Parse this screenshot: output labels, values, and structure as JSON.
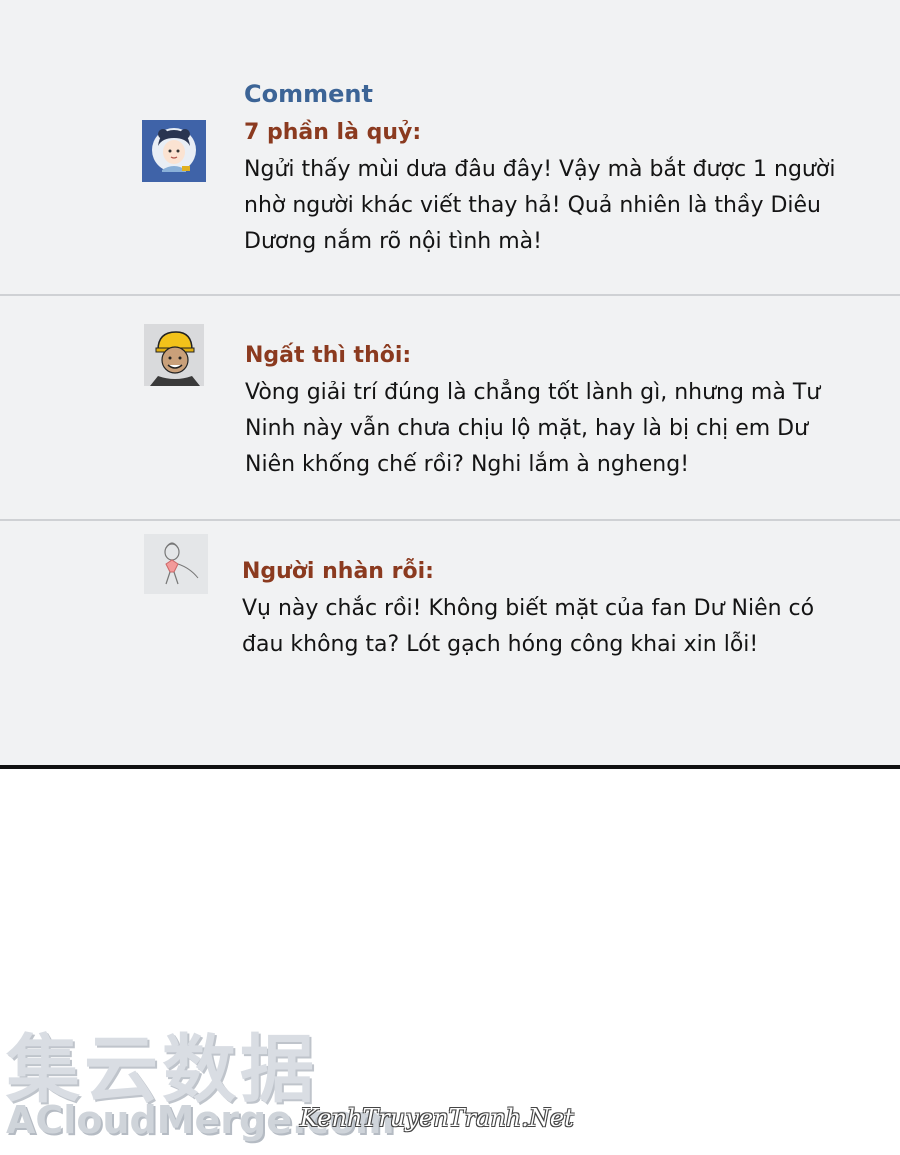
{
  "header": {
    "title": "Comment"
  },
  "comments": [
    {
      "author": "7 phần là quỷ:",
      "avatar_icon": "girl-portrait-avatar-icon",
      "text": "Ngửi thấy mùi dưa đâu đây! Vậy mà bắt được 1 người nhờ người khác viết thay hả! Quả nhiên là thầy Diêu Dương nắm rõ nội tình mà!"
    },
    {
      "author": "Ngất thì thôi:",
      "avatar_icon": "helmet-man-avatar-icon",
      "text": "Vòng giải trí đúng là chẳng tốt lành gì, nhưng mà Tư Ninh này vẫn chưa chịu lộ mặt, hay là bị chị em Dư Niên khống chế rồi? Nghi lắm à ngheng!"
    },
    {
      "author": "Người nhàn rỗi:",
      "avatar_icon": "doodle-figure-avatar-icon",
      "text": "Vụ này chắc rồi! Không biết mặt của fan Dư Niên có đau không ta? Lót gạch hóng công khai xin lỗi!"
    }
  ],
  "watermarks": {
    "cjk": "集云数据",
    "latin": "ACloudMerge.com",
    "site": "KenhTruyenTranh.Net"
  },
  "colors": {
    "header": "#3c6496",
    "author": "#8b3a1f",
    "panel_bg": "#f1f2f3",
    "divider": "#cfd1d4"
  }
}
